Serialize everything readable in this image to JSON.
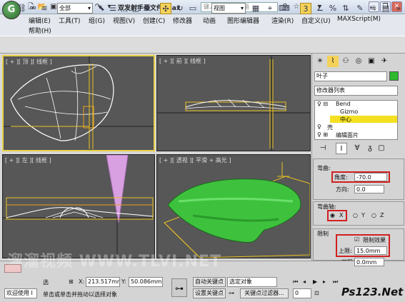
{
  "title_bar": {
    "title": "双发射手蛋文件.max",
    "search_placeholder": "键入关键字或短语"
  },
  "menu": {
    "items": [
      "编辑(E)",
      "工具(T)",
      "组(G)",
      "视图(V)",
      "创建(C)",
      "修改器",
      "动画",
      "图形编辑器",
      "渲染(R)",
      "自定义(U)",
      "MAXScript(M)"
    ],
    "help": "帮助(H)"
  },
  "toolbar": {
    "selection_filter": "全部",
    "ref_coord": "视图",
    "snap_value": "3"
  },
  "viewports": {
    "top": "[ + ][ 顶 ][ 线框 ]",
    "front": "[ + ][ 前 ][ 线框 ]",
    "left": "[ + ][ 左 ][ 线框 ]",
    "perspective": "[ + ][ 透视 ][ 平滑 + 高光 ]"
  },
  "command_panel": {
    "object_name": "叶子",
    "modifier_list": "修改器列表",
    "stack": [
      "Bend",
      "Gizmo",
      "中心",
      "壳",
      "编辑面片"
    ],
    "stack_selected": "中心",
    "bend": {
      "group_label": "弯曲:",
      "angle_label": "角度:",
      "angle_value": "-70.0",
      "direction_label": "方向:",
      "direction_value": "0.0"
    },
    "bend_axis": {
      "group_label": "弯曲轴:",
      "x": "X",
      "y": "Y",
      "z": "Z",
      "selected": "X"
    },
    "limits": {
      "group_label": "限制",
      "limit_effect_label": "限制效果",
      "limit_effect_checked": true,
      "upper_label": "上限:",
      "upper_value": "15.0mm",
      "lower_label": "下限:",
      "lower_value": "0.0mm"
    },
    "accent_color": "#2eb82e"
  },
  "status_bar": {
    "selection_label": "选",
    "x_label": "X:",
    "x_value": "213.517mr",
    "y_label": "Y:",
    "y_value": "50.086mm",
    "welcome": "欢迎使用 I",
    "prompt": "单击或单击并拖动以选择对象",
    "auto_key": "自动关键点",
    "set_key": "设置关键点",
    "selected_object": "选定对象",
    "key_filters": "关键点过滤器...",
    "frame_value": "0"
  },
  "watermark": "溜溜视频 WWW.TLVI.NET",
  "site_logo": "Ps123.Net"
}
